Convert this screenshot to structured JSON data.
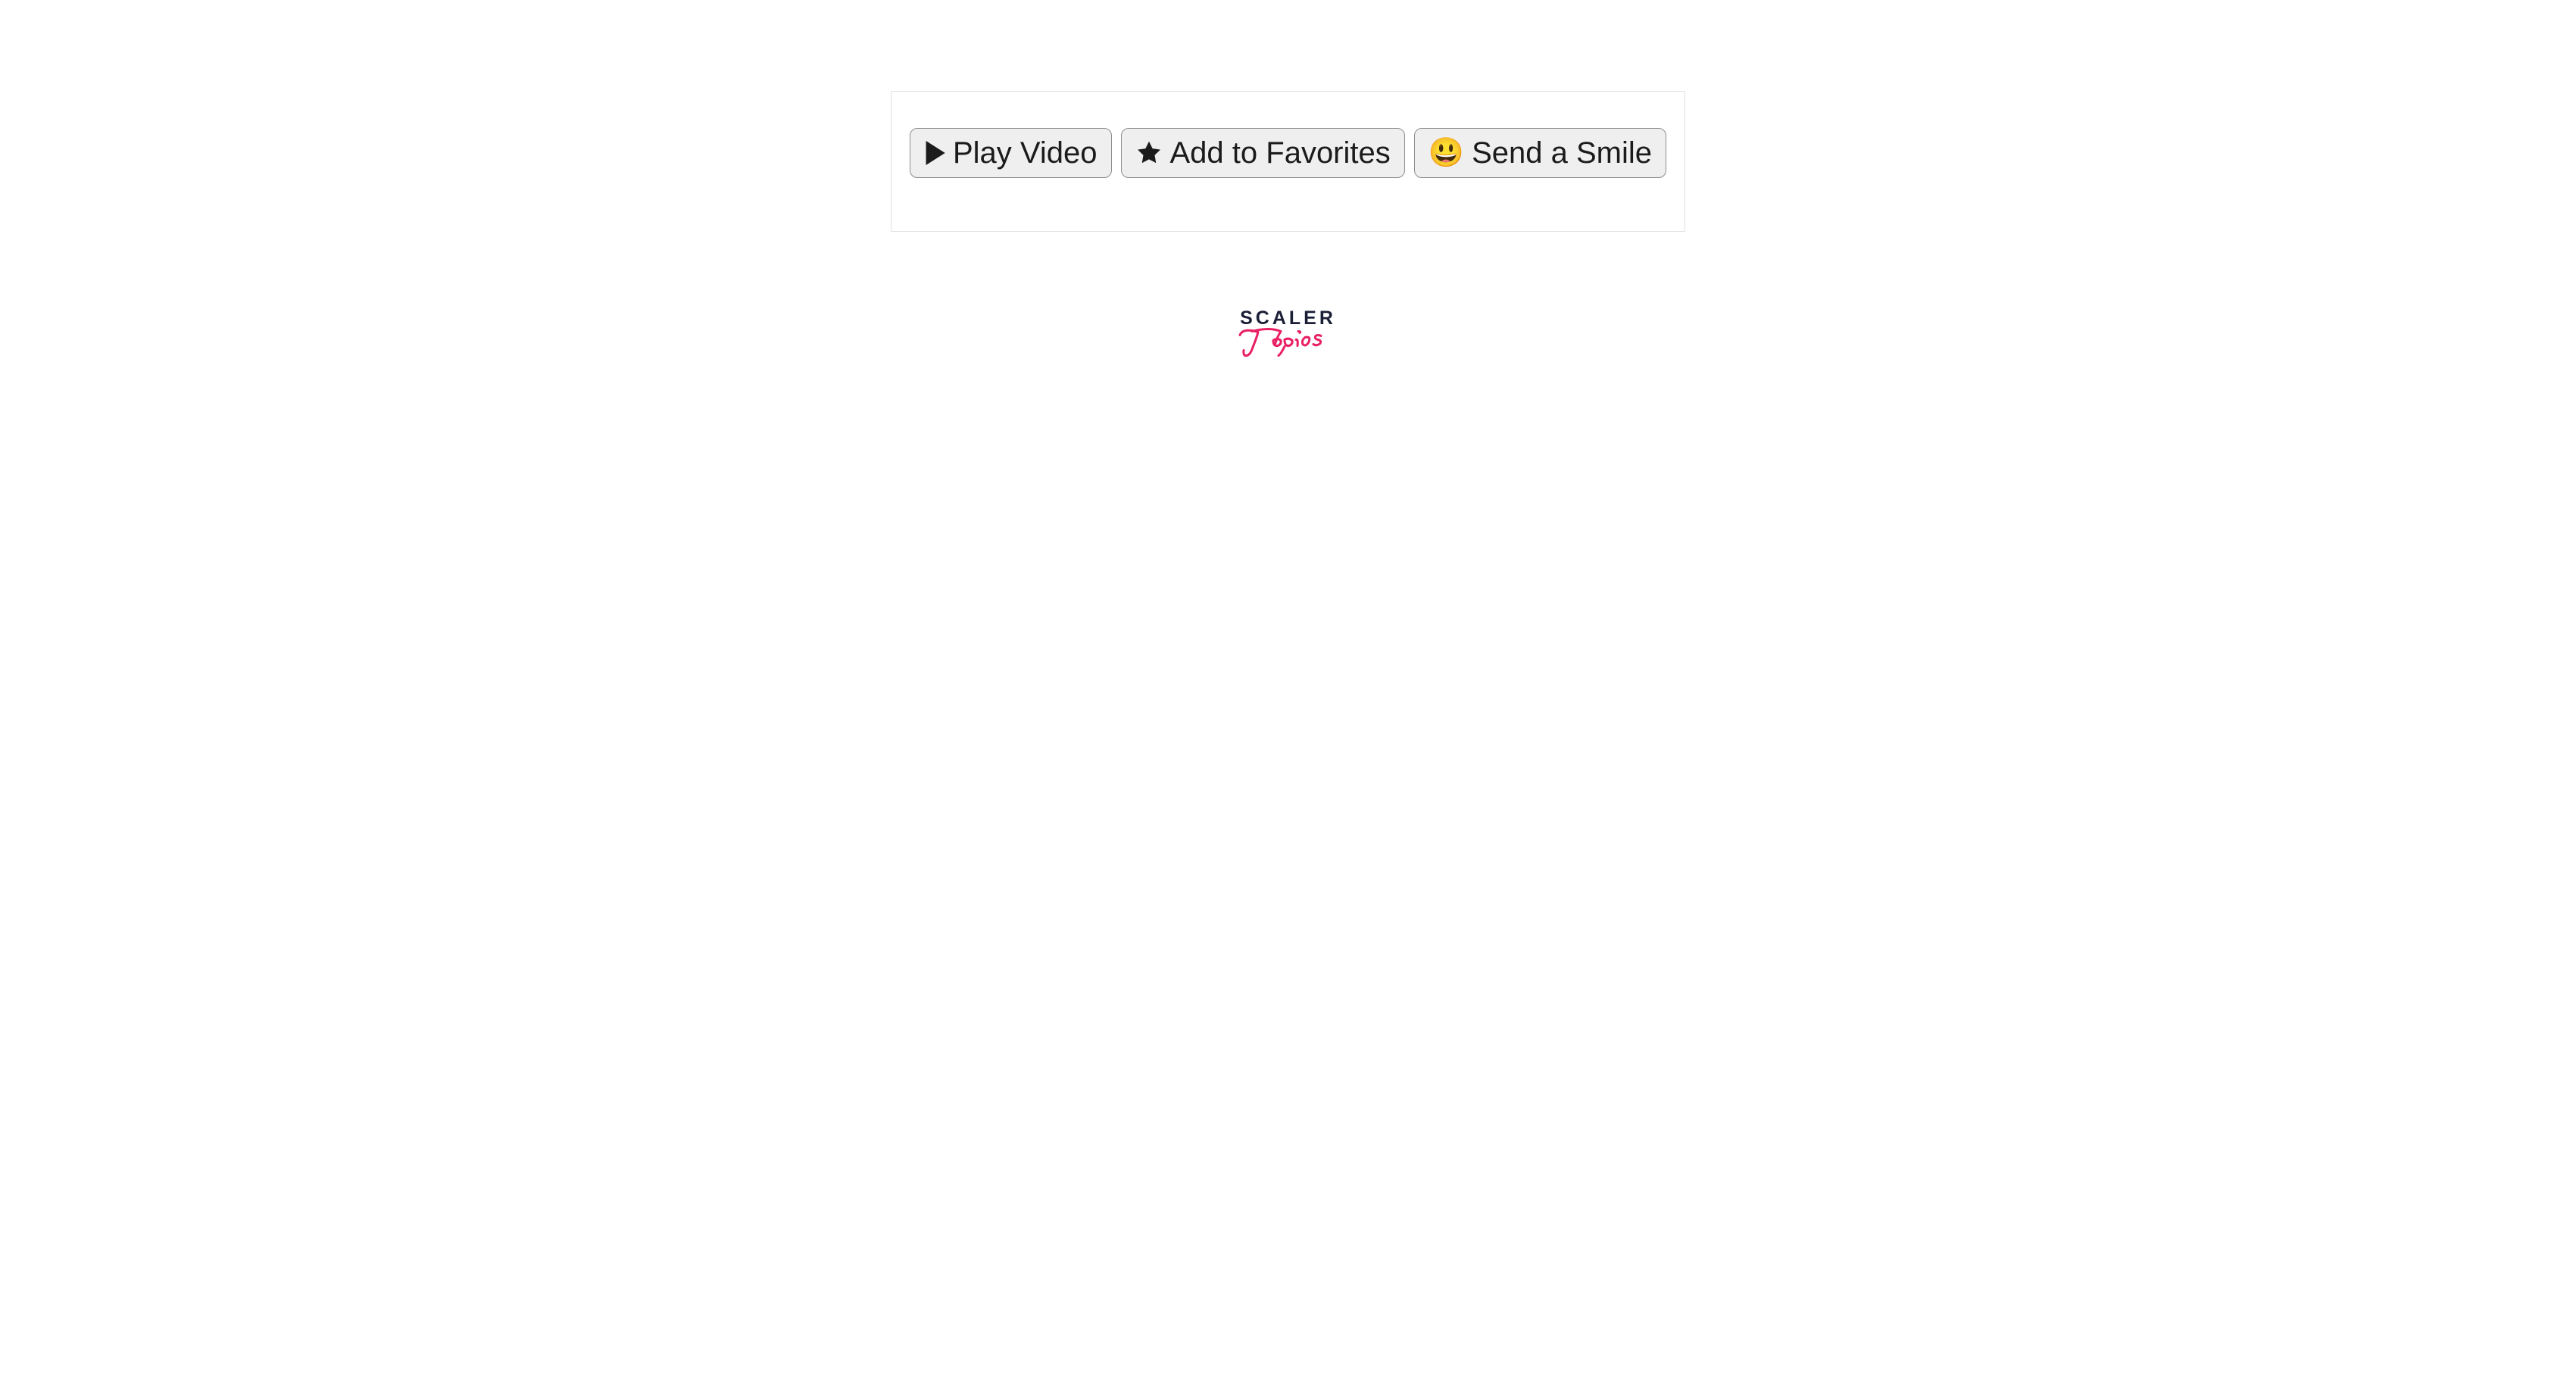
{
  "buttons": {
    "play": {
      "label": "Play Video",
      "icon": "play-icon"
    },
    "favorites": {
      "label": "Add to Favorites",
      "icon": "star-icon"
    },
    "smile": {
      "label": "Send a Smile",
      "icon": "smile-emoji",
      "emoji": "😃"
    }
  },
  "logo": {
    "top": "SCALER",
    "bottom": "Topics"
  }
}
